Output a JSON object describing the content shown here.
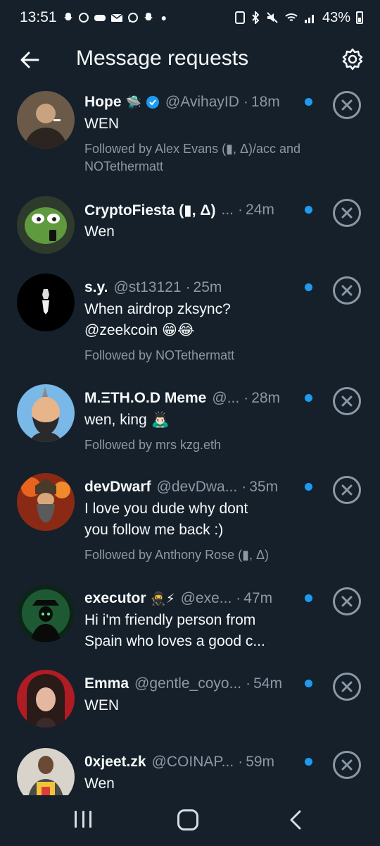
{
  "status_bar": {
    "time": "13:51",
    "battery": "43%",
    "left_icons": [
      "snapchat-icon",
      "wechat-icon",
      "game-icon",
      "gmail-icon",
      "whatsapp-icon",
      "snapchat-icon"
    ],
    "right_icons": [
      "nfc-icon",
      "bluetooth-icon",
      "mute-icon",
      "wifi-icon",
      "signal-icon",
      "battery-icon"
    ]
  },
  "header": {
    "title": "Message requests",
    "back_icon": "arrow-left-icon",
    "settings_icon": "gear-icon"
  },
  "colors": {
    "background": "#15202b",
    "text": "#f7f9f9",
    "muted": "#8b98a5",
    "accent": "#1d9bf0"
  },
  "requests": [
    {
      "name": "Hope",
      "name_emoji": "🛸",
      "verified": true,
      "handle": "@AvihayID",
      "separator": "·",
      "time": "18m",
      "message": [
        "WEN"
      ],
      "followed_by": "Followed by Alex Evans (▮, Δ)/acc and NOTethermatt",
      "unread": true
    },
    {
      "name": "CryptoFiesta (▮, Δ)",
      "name_emoji": "",
      "verified": false,
      "handle": "...",
      "separator": "·",
      "time": "24m",
      "message": [
        "Wen"
      ],
      "followed_by": "",
      "unread": true
    },
    {
      "name": "s.y.",
      "name_emoji": "",
      "verified": false,
      "handle": "@st13121",
      "separator": "·",
      "time": "25m",
      "message": [
        "When airdrop zksync?",
        "@zeekcoin 😁😂"
      ],
      "followed_by": "Followed by NOTethermatt",
      "unread": true
    },
    {
      "name": "M.ΞTH.O.D Meme",
      "name_emoji": "",
      "verified": false,
      "handle": "@...",
      "separator": "·",
      "time": "28m",
      "message": [
        "wen, king 🙇🏻‍♂️"
      ],
      "followed_by": "Followed by mrs kzg.eth",
      "unread": true
    },
    {
      "name": "devDwarf",
      "name_emoji": "",
      "verified": false,
      "handle": "@devDwa...",
      "separator": "·",
      "time": "35m",
      "message": [
        "I love you dude why dont",
        "you follow me back :)"
      ],
      "followed_by": "Followed by Anthony Rose (▮, Δ)",
      "unread": true
    },
    {
      "name": "executor",
      "name_emoji": "🥷⚡",
      "verified": false,
      "handle": "@exe...",
      "separator": "·",
      "time": "47m",
      "message": [
        "Hi i'm friendly person from",
        "Spain who loves a good c..."
      ],
      "followed_by": "",
      "unread": true
    },
    {
      "name": "Emma",
      "name_emoji": "",
      "verified": false,
      "handle": "@gentle_coyo...",
      "separator": "·",
      "time": "54m",
      "message": [
        "WEN"
      ],
      "followed_by": "",
      "unread": true
    },
    {
      "name": "0xjeet.zk",
      "name_emoji": "",
      "verified": false,
      "handle": "@COINAP...",
      "separator": "·",
      "time": "59m",
      "message": [
        "Wen"
      ],
      "followed_by": "",
      "unread": true
    }
  ],
  "navbar": {
    "recent_icon": "recent-apps-icon",
    "home_icon": "home-icon",
    "back_icon": "back-icon"
  }
}
